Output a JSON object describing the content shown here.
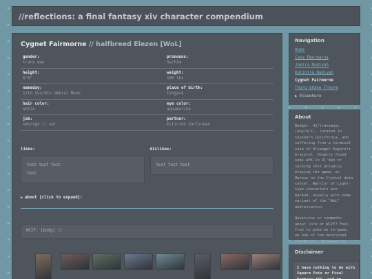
{
  "site": {
    "title": "//reflections: a final fantasy xiv character compendium"
  },
  "character": {
    "name": "Cygnet Fairmorne",
    "subtitle": "// halfbreed Elezen [WoL]",
    "fields": [
      {
        "label": "gender:",
        "value": "trans man"
      },
      {
        "label": "pronouns:",
        "value": "he/him"
      },
      {
        "label": "height:",
        "value": "6'6\""
      },
      {
        "label": "weight:",
        "value": "180 lbs"
      },
      {
        "label": "nameday:",
        "value": "12th Sun/6th Umbral Moon"
      },
      {
        "label": "place of birth:",
        "value": "Ishgard"
      },
      {
        "label": "hair color:",
        "value": "white"
      },
      {
        "label": "eye color:",
        "value": "aquamarine"
      },
      {
        "label": "job:",
        "value": "smn/sge // wvr"
      },
      {
        "label": "partner:",
        "value": "Estinien Varlineau"
      }
    ],
    "likes": {
      "label": "likes:",
      "items": [
        "test test test",
        "test"
      ]
    },
    "dislikes": {
      "label": "dislikes:",
      "items": [
        "test test test"
      ]
    },
    "about_toggle": "about [click to expand]:",
    "wcif": "WCIF: [body] //"
  },
  "icons": {
    "expand": "triangle-right-icon",
    "elsewhere": "triangle-right-icon"
  },
  "colors": {
    "link": "#7fb7cb",
    "accent_line": "#7aa8b8",
    "background": "#6f97a4"
  },
  "gallery": [
    {
      "alt": "screenshot-1",
      "color": "#7c6a5c"
    },
    {
      "alt": "screenshot-2",
      "color": "#6e5a5a"
    },
    {
      "alt": "screenshot-3",
      "color": "#5f6e63"
    },
    {
      "alt": "screenshot-4",
      "color": "#6a7890"
    },
    {
      "alt": "screenshot-5",
      "color": "#6f8a95"
    },
    {
      "alt": "screenshot-6",
      "color": "#5b5a66"
    },
    {
      "alt": "screenshot-7",
      "color": "#8a6a62"
    },
    {
      "alt": "screenshot-8",
      "color": "#9a7f7a"
    }
  ],
  "sidebar": {
    "navigation": {
      "title": "Navigation",
      "links": [
        "Home",
        "Cass Emerbarus",
        "Jakira Nadiyah",
        "Kalinira Nadiyah",
        "Cygnet Fairmorne",
        "Thoru'shane Trevre"
      ],
      "current": "Cygnet Fairmorne",
      "elsewhere": "Elsewhere"
    },
    "about": {
      "title": "About",
      "text": "Badger. 42/transmasc (any/all), located in southern California, and suffering from a terminal case of Urianger Augurelt brainrot. Usually found semi-AFK in Ul'dah or sucking shit actually playing the game, on Mateus on the Crystal data center. Warrior of Light-type characters are marked, usually with some variant of the \"WoL\" abbreviation.",
      "text2": "Questions or comments about lore or WCIF? Feel free to poke me in-game, on one of the mentioned characters, bluesky, or discord."
    },
    "disclaimer": {
      "title": "Disclaimer",
      "text": "I have nothing to do with Square Enix or Final Fantasy XIV, and am unaffiliated"
    }
  }
}
